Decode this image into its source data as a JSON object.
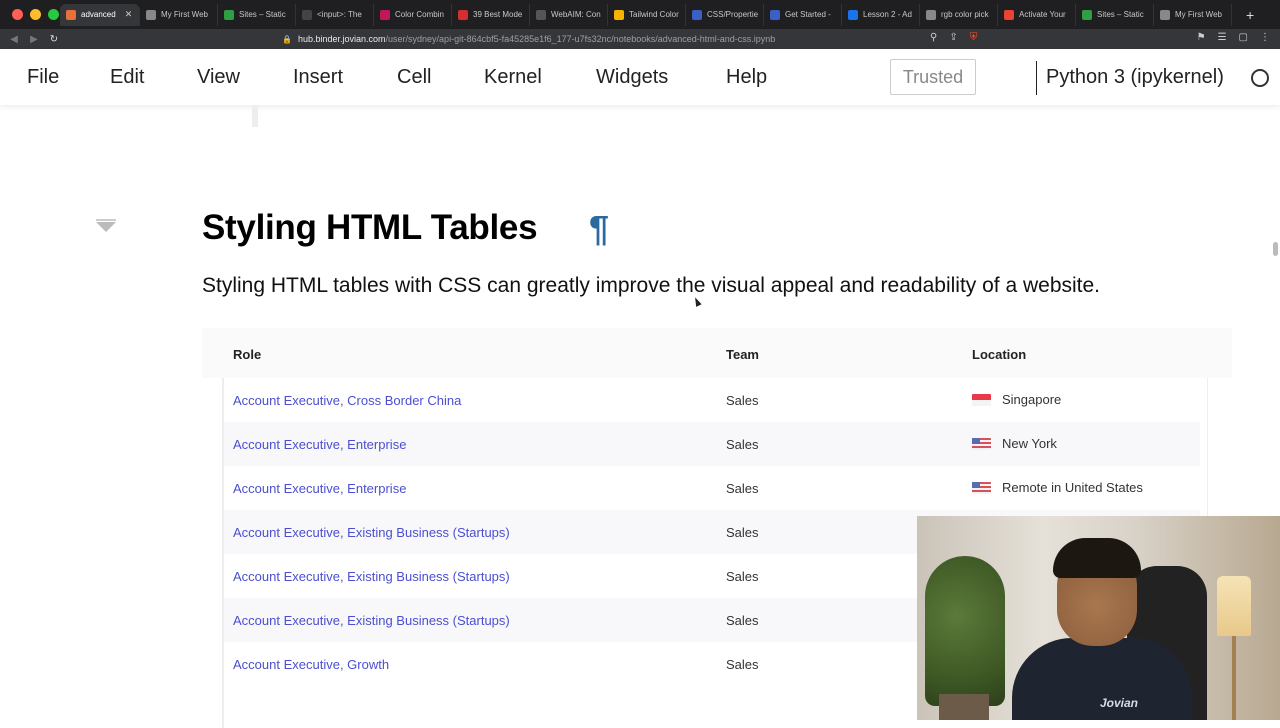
{
  "browser": {
    "tabs": [
      {
        "title": "advanced",
        "active": true,
        "color": "#e8713a"
      },
      {
        "title": "My First Web",
        "color": "#888888"
      },
      {
        "title": "Sites – Static",
        "color": "#2ea043"
      },
      {
        "title": "<input>: The",
        "color": "#444444"
      },
      {
        "title": "Color Combin",
        "color": "#c2185b"
      },
      {
        "title": "39 Best Mode",
        "color": "#d32f2f"
      },
      {
        "title": "WebAIM: Con",
        "color": "#555555"
      },
      {
        "title": "Tailwind Color",
        "color": "#f4b400"
      },
      {
        "title": "CSS/Propertie",
        "color": "#3b5fc4"
      },
      {
        "title": "Get Started -",
        "color": "#3b5fc4"
      },
      {
        "title": "Lesson 2 - Ad",
        "color": "#1a73e8"
      },
      {
        "title": "rgb color pick",
        "color": "#888888"
      },
      {
        "title": "Activate Your",
        "color": "#ea4335"
      },
      {
        "title": "Sites – Static",
        "color": "#2ea043"
      },
      {
        "title": "My First Web",
        "color": "#888888"
      }
    ],
    "new_tab": "+",
    "url_host": "hub.binder.jovian.com",
    "url_path": "/user/sydney/api-git-864cbf5-fa45285e1f6_177-u7fs32nc/notebooks/advanced-html-and-css.ipynb"
  },
  "menubar": {
    "items": [
      "File",
      "Edit",
      "View",
      "Insert",
      "Cell",
      "Kernel",
      "Widgets",
      "Help"
    ],
    "trusted": "Trusted",
    "kernel": "Python 3 (ipykernel)"
  },
  "cell": {
    "title": "Styling HTML Tables",
    "anchor": "¶",
    "description": "Styling HTML tables with CSS can greatly improve the visual appeal and readability of a website."
  },
  "table": {
    "headers": [
      "Role",
      "Team",
      "Location"
    ],
    "rows": [
      {
        "role": "Account Executive, Cross Border China",
        "team": "Sales",
        "location": "Singapore",
        "flag": "sg"
      },
      {
        "role": "Account Executive, Enterprise",
        "team": "Sales",
        "location": "New York",
        "flag": "us"
      },
      {
        "role": "Account Executive, Enterprise",
        "team": "Sales",
        "location": "Remote in United States",
        "flag": "us"
      },
      {
        "role": "Account Executive, Existing Business (Startups)",
        "team": "Sales",
        "location": "",
        "flag": ""
      },
      {
        "role": "Account Executive, Existing Business (Startups)",
        "team": "Sales",
        "location": "",
        "flag": ""
      },
      {
        "role": "Account Executive, Existing Business (Startups)",
        "team": "Sales",
        "location": "",
        "flag": ""
      },
      {
        "role": "Account Executive, Growth",
        "team": "Sales",
        "location": "",
        "flag": ""
      }
    ]
  },
  "webcam": {
    "logo": "Jovian"
  },
  "colors": {
    "link": "#4b4fcf",
    "anchor": "#2a6aa0"
  }
}
